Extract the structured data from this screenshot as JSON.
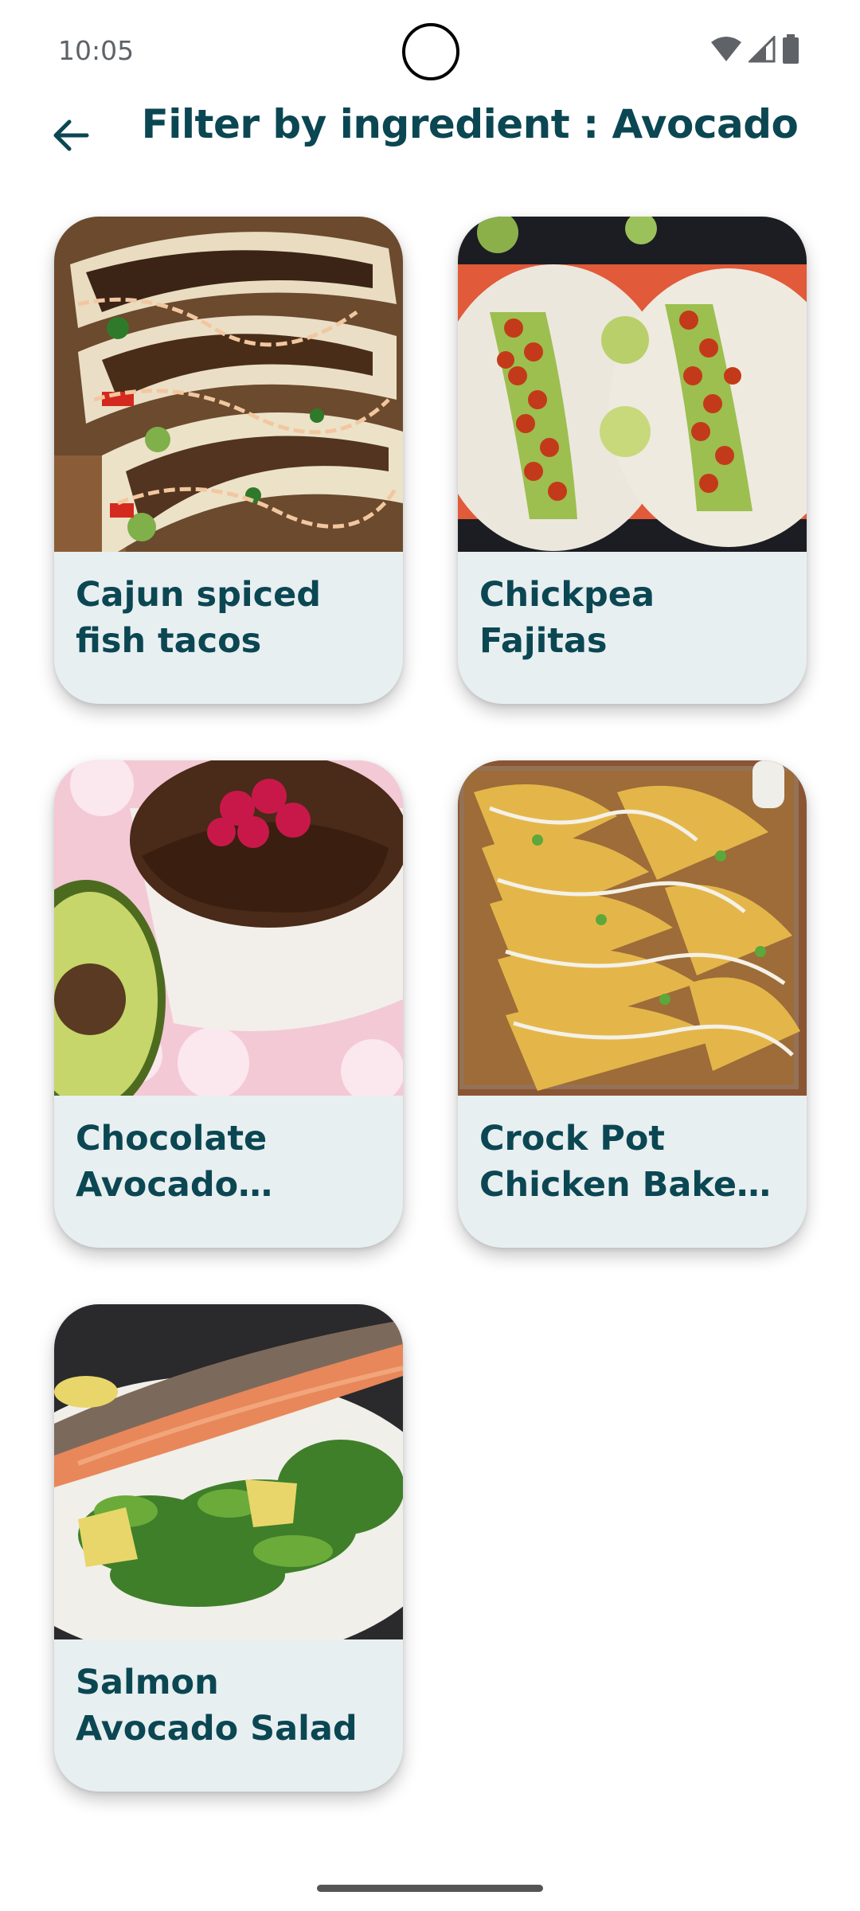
{
  "status_bar": {
    "time": "10:05",
    "icons": [
      "wifi-icon",
      "signal-icon",
      "battery-icon"
    ]
  },
  "header": {
    "back_icon": "arrow-left-icon",
    "title": "Filter by ingredient : Avocado"
  },
  "colors": {
    "accent": "#0b4752",
    "card_background": "#e8eff1",
    "page_background": "#ffffff"
  },
  "recipes": [
    {
      "title": "Cajun spiced fish tacos",
      "image": "fish-tacos-photo"
    },
    {
      "title": "Chickpea Fajitas",
      "image": "chickpea-fajitas-photo"
    },
    {
      "title": "Chocolate Avocado Mousse",
      "image": "chocolate-mousse-photo"
    },
    {
      "title": "Crock Pot Chicken Baked Tacos",
      "image": "baked-tacos-photo"
    },
    {
      "title": "Salmon Avocado Salad",
      "image": "salmon-salad-photo"
    }
  ]
}
